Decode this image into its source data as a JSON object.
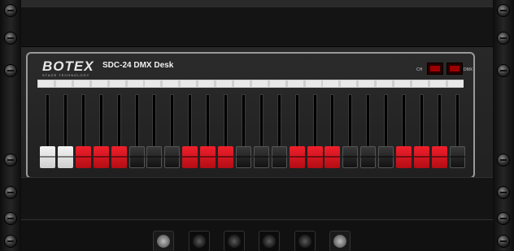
{
  "desk": {
    "brand": "BOTEX",
    "tagline": "STAGE TECHNOLOGY",
    "model": "SDC-24 DMX Desk",
    "display_labels": {
      "ch": "CH",
      "dmx": "DMX"
    }
  },
  "faders": {
    "count": 24,
    "knob_colors": [
      "white",
      "white",
      "red",
      "red",
      "red",
      "black",
      "black",
      "black",
      "red",
      "red",
      "red",
      "black",
      "black",
      "black",
      "red",
      "red",
      "red",
      "black",
      "black",
      "black",
      "red",
      "red",
      "red",
      "black"
    ]
  },
  "colors": {
    "red_knob": "#e0141f",
    "white_knob": "#f0f0f0",
    "black_knob": "#1c1c1c",
    "panel": "#141414"
  }
}
